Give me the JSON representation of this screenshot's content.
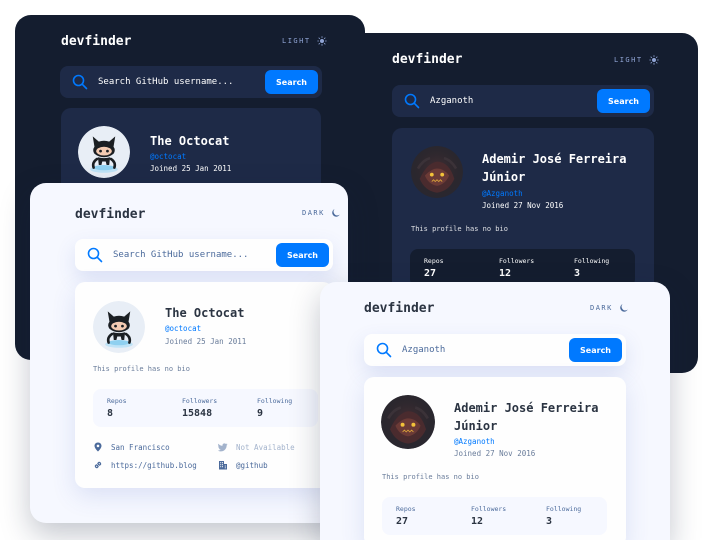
{
  "brand": {
    "logo": "devfinder",
    "accent": "#0079ff"
  },
  "mode_labels": {
    "light": "LIGHT",
    "dark": "DARK"
  },
  "search": {
    "placeholder": "Search GitHub username...",
    "button": "Search"
  },
  "octocat": {
    "name": "The Octocat",
    "handle": "@octocat",
    "joined": "Joined 25 Jan 2011",
    "bio": "This profile has no bio",
    "stats": [
      {
        "label": "Repos",
        "value": "8"
      },
      {
        "label": "Followers",
        "value": "15848"
      },
      {
        "label": "Following",
        "value": "9"
      }
    ],
    "links": {
      "location": "San Francisco",
      "twitter": "Not Available",
      "website": "https://github.blog",
      "company": "@github"
    }
  },
  "azganoth": {
    "query": "Azganoth",
    "name_line1": "Ademir José Ferreira",
    "name_line2": "Júnior",
    "handle": "@Azganoth",
    "joined": "Joined 27 Nov 2016",
    "bio": "This profile has no bio",
    "stats": [
      {
        "label": "Repos",
        "value": "27"
      },
      {
        "label": "Followers",
        "value": "12"
      },
      {
        "label": "Following",
        "value": "3"
      }
    ]
  }
}
